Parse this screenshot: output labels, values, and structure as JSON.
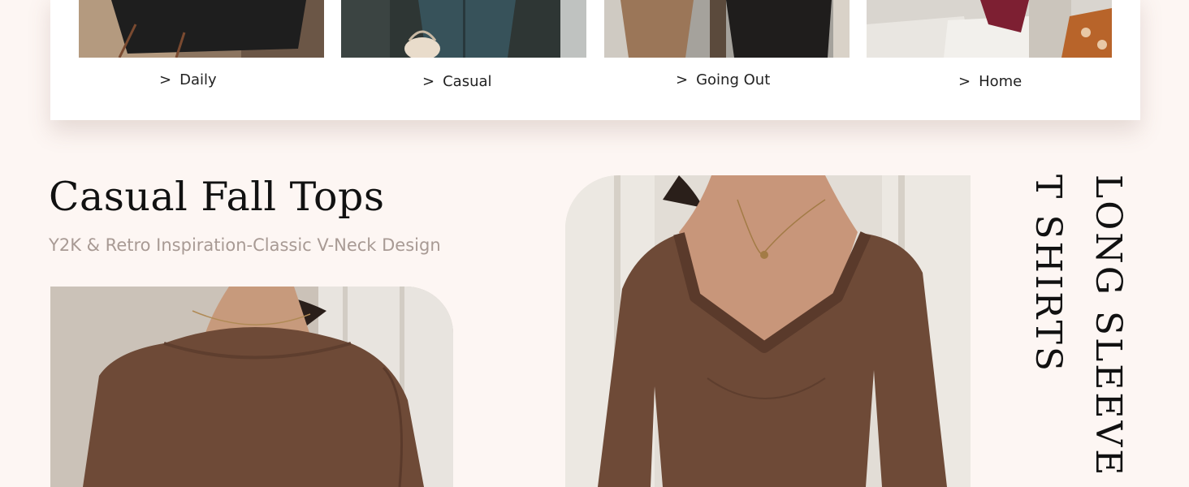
{
  "categories": [
    {
      "label": "Daily"
    },
    {
      "label": "Casual"
    },
    {
      "label": "Going Out"
    },
    {
      "label": "Home"
    }
  ],
  "chevron": ">",
  "feature": {
    "title": "Casual Fall Tops",
    "subtitle": "Y2K & Retro Inspiration-Classic V-Neck Design",
    "vertical_line_1": "LONG SLEEVE",
    "vertical_line_2": "T SHIRTS"
  },
  "colors": {
    "page_background": "#fdf6f3",
    "shirt_brown": "#6e4a37",
    "subtitle_gray": "#a89a94"
  }
}
